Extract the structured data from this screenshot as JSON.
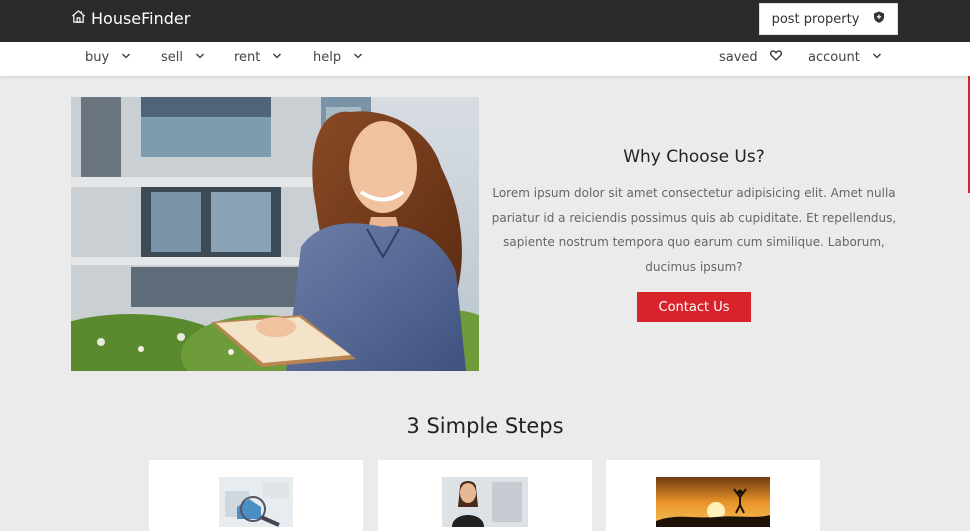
{
  "header": {
    "brand": "HouseFinder",
    "post_property": "post property"
  },
  "nav": {
    "buy": "buy",
    "sell": "sell",
    "rent": "rent",
    "help": "help",
    "saved": "saved",
    "account": "account"
  },
  "hero": {
    "title": "Why Choose Us?",
    "body": "Lorem ipsum dolor sit amet consectetur adipisicing elit. Amet nulla pariatur id a reiciendis possimus quis ab cupiditate. Et repellendus, sapiente nostrum tempora quo earum cum similique. Laborum, ducimus ipsum?",
    "contact_button": "Contact Us"
  },
  "steps": {
    "title": "3 Simple Steps"
  },
  "colors": {
    "accent": "#d8232a",
    "topbar": "#2b2b2b",
    "background": "#ebebeb"
  },
  "icons": {
    "brand": "house-icon",
    "post": "shield-icon",
    "dropdown": "chevron-down-icon",
    "saved": "heart-icon"
  }
}
